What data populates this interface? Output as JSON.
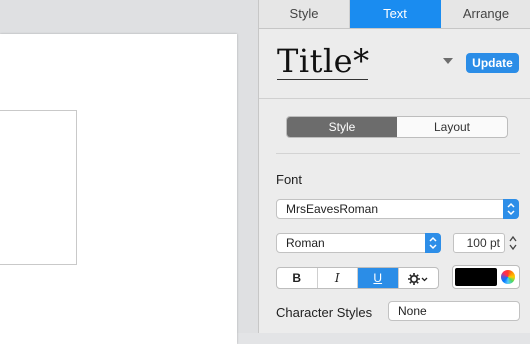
{
  "inspector": {
    "tabs": [
      "Style",
      "Text",
      "Arrange"
    ],
    "active_tab": "Text",
    "style_preview": {
      "title": "Title*",
      "update_label": "Update"
    },
    "segments": [
      "Style",
      "Layout"
    ],
    "active_segment": "Style",
    "font": {
      "heading": "Font",
      "family": "MrsEavesRoman",
      "typeface": "Roman",
      "size": "100 pt",
      "format_buttons": {
        "bold": "B",
        "italic": "I",
        "underline": "U"
      },
      "color": "#000000"
    },
    "character_styles": {
      "label": "Character Styles",
      "value": "None"
    }
  },
  "colors": {
    "accent": "#2b8de7",
    "tab_active": "#1a8cf0",
    "segment_active": "#6c6c6c"
  }
}
